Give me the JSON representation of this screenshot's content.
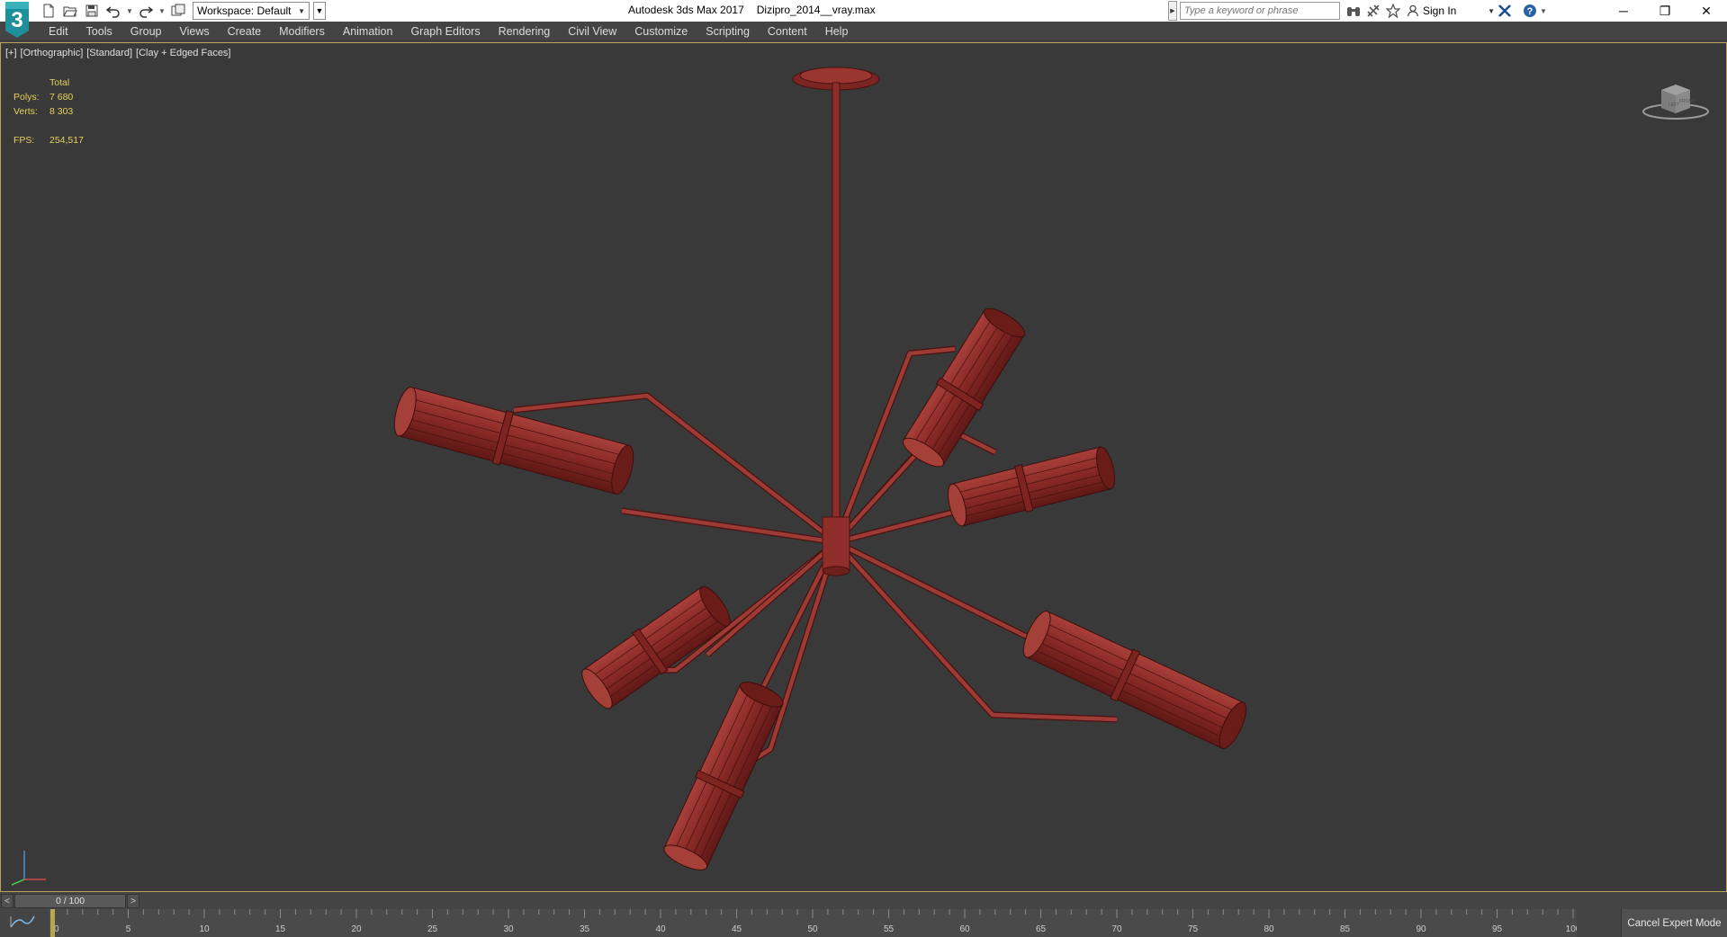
{
  "app": {
    "logo_text": "3",
    "title": "Autodesk 3ds Max 2017",
    "filename": "Dizipro_2014__vray.max"
  },
  "toolbar": {
    "workspace_label": "Workspace: Default"
  },
  "search": {
    "placeholder": "Type a keyword or phrase"
  },
  "account": {
    "sign_in_label": "Sign In"
  },
  "menu": {
    "items": [
      "Edit",
      "Tools",
      "Group",
      "Views",
      "Create",
      "Modifiers",
      "Animation",
      "Graph Editors",
      "Rendering",
      "Civil View",
      "Customize",
      "Scripting",
      "Content",
      "Help"
    ]
  },
  "viewport": {
    "labels": [
      "[+]",
      "[Orthographic]",
      "[Standard]",
      "[Clay + Edged Faces]"
    ],
    "stats": {
      "header": "Total",
      "polys_label": "Polys:",
      "polys_value": "7 680",
      "verts_label": "Verts:",
      "verts_value": "8 303",
      "fps_label": "FPS:",
      "fps_value": "254,517"
    },
    "model_color": "#8a2a26",
    "viewcube_labels": [
      "LEFT",
      "FRONT"
    ]
  },
  "timeslider": {
    "prev_label": "<",
    "frame_label": "0 / 100",
    "next_label": ">"
  },
  "trackbar": {
    "tick_labels": [
      "0",
      "5",
      "10",
      "15",
      "20",
      "25",
      "30",
      "35",
      "40",
      "45",
      "50",
      "55",
      "60",
      "65",
      "70",
      "75",
      "80",
      "85",
      "90",
      "95",
      "100"
    ],
    "frame_start": 0,
    "frame_end": 100,
    "current_frame": 0
  },
  "expert_mode": {
    "cancel_label": "Cancel Expert Mode"
  }
}
